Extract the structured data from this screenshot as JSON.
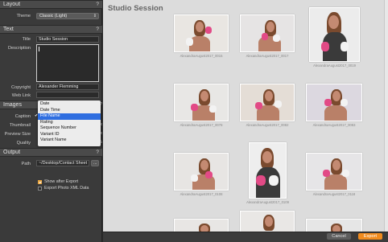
{
  "layout": {
    "section": "Layout",
    "help": "?",
    "theme_label": "Theme",
    "theme_value": "Classic (Light)"
  },
  "text": {
    "section": "Text",
    "help": "?",
    "title_label": "Title",
    "title_value": "Studio Session",
    "description_label": "Description",
    "copyright_label": "Copyright",
    "copyright_value": "Alexander Flemming",
    "weblink_label": "Web Link"
  },
  "images": {
    "section": "Images",
    "caption_label": "Caption",
    "thumbnail_label": "Thumbnail",
    "preview_label": "Preview Size",
    "quality_label": "Quality",
    "side_help": "?",
    "side_2": "ix",
    "side_3": "ix",
    "side_4": "%"
  },
  "caption_menu": {
    "items": [
      "Date",
      "Date Time",
      "File Name",
      "Rating",
      "Sequence Number",
      "Variant ID",
      "Variant Name"
    ],
    "selected_index": 2
  },
  "output": {
    "section": "Output",
    "help": "?",
    "path_label": "Path",
    "path_value": "~/Desktop/Contact Sheet",
    "browse": "...",
    "show_after_export": "Show after Export",
    "export_xml": "Export Photo XML Data",
    "show_after_checked": true,
    "xml_checked": false
  },
  "sheet": {
    "title": "Studio Session",
    "captions": [
      "AlexandraAugust2017_0015",
      "AlexandraAugust2017_0017",
      "AlexandraAugust2017_0019",
      "AlexandraAugust2017_0078",
      "AlexandraAugust2017_0082",
      "AlexandraAugust2017_0083",
      "AlexandraAugust2017_0108",
      "AlexandraAugust2017_0109",
      "AlexandraAugust2017_0118"
    ]
  },
  "footer": {
    "cancel": "Cancel",
    "export": "Export"
  },
  "colors": {
    "accent": "#f08b1e",
    "menu_highlight": "#2f6ee0"
  }
}
